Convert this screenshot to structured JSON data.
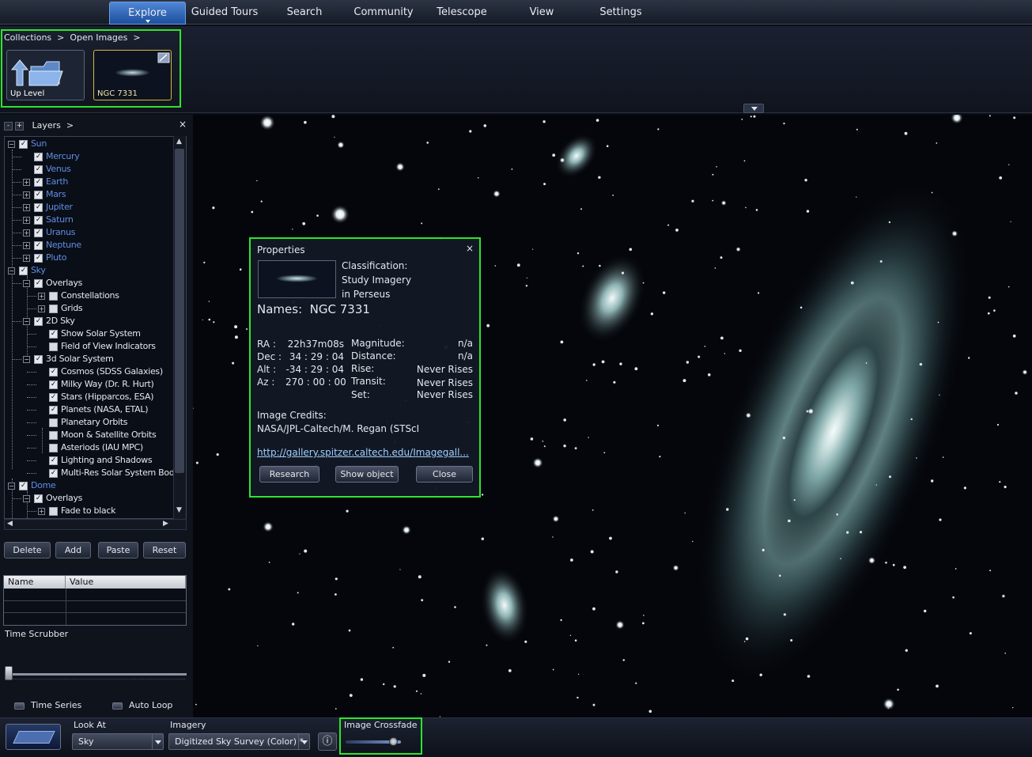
{
  "menu": {
    "items": [
      {
        "label": "Explore"
      },
      {
        "label": "Guided Tours"
      },
      {
        "label": "Search"
      },
      {
        "label": "Community"
      },
      {
        "label": "Telescope"
      },
      {
        "label": "View"
      },
      {
        "label": "Settings"
      }
    ]
  },
  "collections": {
    "breadcrumb": "Collections  >  Open Images  >",
    "up_level": "Up Level",
    "image_name": "NGC 7331"
  },
  "layers": {
    "title": "Layers  >",
    "minus": "-",
    "plus": "+",
    "close": "×",
    "tree": [
      {
        "label": "Sun",
        "checked": true,
        "color": "blue",
        "indent": 0,
        "expander": "-"
      },
      {
        "label": "Mercury",
        "checked": true,
        "color": "blue",
        "indent": 1,
        "expander": ""
      },
      {
        "label": "Venus",
        "checked": true,
        "color": "blue",
        "indent": 1,
        "expander": ""
      },
      {
        "label": "Earth",
        "checked": true,
        "color": "blue",
        "indent": 1,
        "expander": "+"
      },
      {
        "label": "Mars",
        "checked": true,
        "color": "blue",
        "indent": 1,
        "expander": "+"
      },
      {
        "label": "Jupiter",
        "checked": true,
        "color": "blue",
        "indent": 1,
        "expander": "+"
      },
      {
        "label": "Saturn",
        "checked": true,
        "color": "blue",
        "indent": 1,
        "expander": "+"
      },
      {
        "label": "Uranus",
        "checked": true,
        "color": "blue",
        "indent": 1,
        "expander": "+"
      },
      {
        "label": "Neptune",
        "checked": true,
        "color": "blue",
        "indent": 1,
        "expander": "+"
      },
      {
        "label": "Pluto",
        "checked": true,
        "color": "blue",
        "indent": 1,
        "expander": "+"
      },
      {
        "label": "Sky",
        "checked": true,
        "color": "blue",
        "indent": 0,
        "expander": "-"
      },
      {
        "label": "Overlays",
        "checked": true,
        "color": "white",
        "indent": 1,
        "expander": "-"
      },
      {
        "label": "Constellations",
        "checked": false,
        "color": "white",
        "indent": 2,
        "expander": "+"
      },
      {
        "label": "Grids",
        "checked": false,
        "color": "white",
        "indent": 2,
        "expander": "+"
      },
      {
        "label": "2D Sky",
        "checked": true,
        "color": "white",
        "indent": 1,
        "expander": "-"
      },
      {
        "label": "Show Solar System",
        "checked": true,
        "color": "white",
        "indent": 2,
        "expander": ""
      },
      {
        "label": "Field of View Indicators",
        "checked": false,
        "color": "white",
        "indent": 2,
        "expander": ""
      },
      {
        "label": "3d Solar System",
        "checked": true,
        "color": "white",
        "indent": 1,
        "expander": "-"
      },
      {
        "label": "Cosmos (SDSS Galaxies)",
        "checked": true,
        "color": "white",
        "indent": 2,
        "expander": ""
      },
      {
        "label": "Milky Way (Dr. R. Hurt)",
        "checked": true,
        "color": "white",
        "indent": 2,
        "expander": ""
      },
      {
        "label": "Stars (Hipparcos, ESA)",
        "checked": true,
        "color": "white",
        "indent": 2,
        "expander": ""
      },
      {
        "label": "Planets (NASA, ETAL)",
        "checked": true,
        "color": "white",
        "indent": 2,
        "expander": ""
      },
      {
        "label": "Planetary Orbits",
        "checked": false,
        "color": "white",
        "indent": 2,
        "expander": ""
      },
      {
        "label": "Moon & Satellite Orbits",
        "checked": false,
        "color": "white",
        "indent": 2,
        "expander": ""
      },
      {
        "label": "Asteriods (IAU MPC)",
        "checked": false,
        "color": "white",
        "indent": 2,
        "expander": ""
      },
      {
        "label": "Lighting and Shadows",
        "checked": true,
        "color": "white",
        "indent": 2,
        "expander": ""
      },
      {
        "label": "Multi-Res Solar System Bodies",
        "checked": true,
        "color": "white",
        "indent": 2,
        "expander": ""
      },
      {
        "label": "Dome",
        "checked": true,
        "color": "blue",
        "indent": 0,
        "expander": "-"
      },
      {
        "label": "Overlays",
        "checked": true,
        "color": "white",
        "indent": 1,
        "expander": "-"
      },
      {
        "label": "Fade to black",
        "checked": false,
        "color": "white",
        "indent": 2,
        "expander": "+"
      }
    ],
    "buttons": {
      "delete": "Delete",
      "add": "Add",
      "paste": "Paste",
      "reset": "Reset"
    },
    "grid": {
      "col_name": "Name",
      "col_value": "Value"
    }
  },
  "time": {
    "scrubber_label": "Time Scrubber",
    "time_series": "Time Series",
    "auto_loop": "Auto Loop"
  },
  "properties": {
    "title": "Properties",
    "close": "×",
    "classification": [
      "Classification:",
      "Study Imagery",
      "in Perseus"
    ],
    "names": "Names:  NGC 7331",
    "ra_label": "RA :",
    "ra": "22h37m08s",
    "dec_label": "Dec :",
    "dec": "34 : 29 : 04",
    "alt_label": "Alt :",
    "alt": "-34 : 29 : 04",
    "az_label": "Az :",
    "az": "270 : 00 : 00",
    "magnitude_label": "Magnitude:",
    "magnitude": "n/a",
    "distance_label": "Distance:",
    "distance": "n/a",
    "rise_label": "Rise:",
    "rise": "Never Rises",
    "transit_label": "Transit:",
    "transit": "Never Rises",
    "set_label": "Set:",
    "set": "Never Rises",
    "credits_label": "Image Credits:",
    "credits": "NASA/JPL-Caltech/M. Regan (STScI",
    "link": "http://gallery.spitzer.caltech.edu/Imagegall...",
    "research": "Research",
    "show_object": "Show object",
    "close_btn": "Close"
  },
  "bottom": {
    "look_at_label": "Look At",
    "look_at_value": "Sky",
    "imagery_label": "Imagery",
    "imagery_value": "Digitized Sky Survey (Color) *",
    "info": "ⓘ",
    "crossfade_label": "Image Crossfade",
    "crossfade_level": 0.85
  }
}
